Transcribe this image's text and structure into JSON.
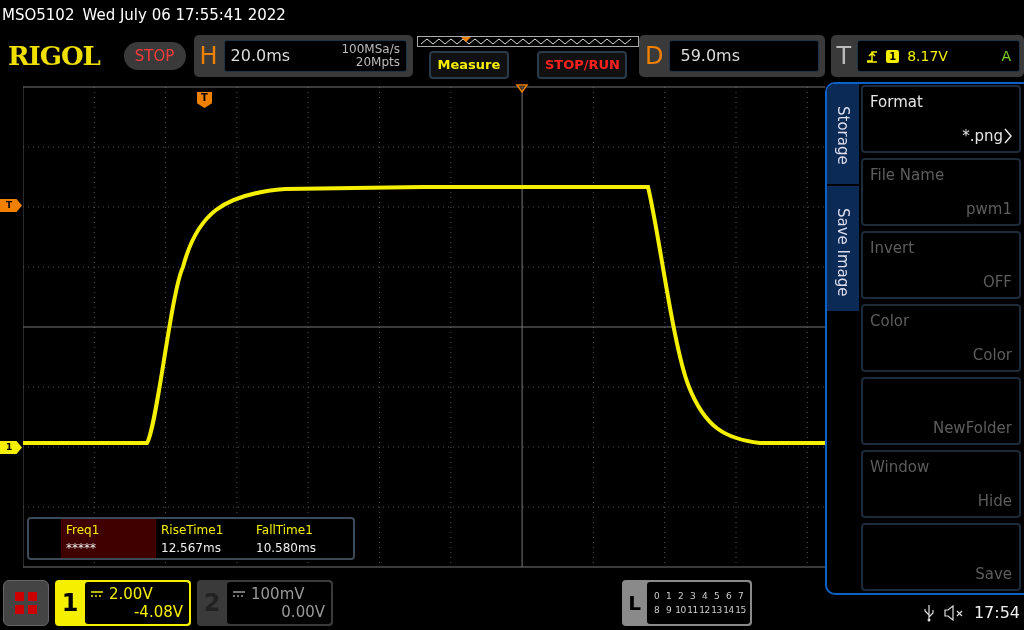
{
  "status_line": {
    "model": "MSO5102",
    "datetime": "Wed July 06 17:55:41 2022"
  },
  "toolbar": {
    "logo": "RIGOL",
    "run_state": "STOP",
    "horizontal": {
      "label": "H",
      "timebase": "20.0ms",
      "sample_rate": "100MSa/s",
      "memory_depth": "20Mpts"
    },
    "buttons": [
      {
        "label": "Measure",
        "kind": "measure"
      },
      {
        "label": "STOP/RUN",
        "kind": "run_control"
      }
    ],
    "delay": {
      "label": "D",
      "value": "59.0ms"
    },
    "trigger": {
      "label": "T",
      "source": "1",
      "level": "8.17V",
      "mode": "A"
    }
  },
  "display": {
    "markers": [
      {
        "kind": "trigger_position",
        "label": "T"
      },
      {
        "kind": "trigger_level",
        "label": "T"
      },
      {
        "kind": "channel_offset",
        "label": "1"
      }
    ]
  },
  "measurements": [
    {
      "name": "Freq1",
      "value": "*****",
      "selected": true
    },
    {
      "name": "RiseTime1",
      "value": "12.567ms",
      "selected": false
    },
    {
      "name": "FallTime1",
      "value": "10.580ms",
      "selected": false
    }
  ],
  "side_menu": {
    "tabs": [
      {
        "label": "Storage"
      },
      {
        "label": "Save Image"
      }
    ],
    "items": [
      {
        "label": "Format",
        "value": "*.png",
        "disabled": false,
        "submenu": true
      },
      {
        "label": "File Name",
        "value": "pwm1",
        "disabled": true,
        "submenu": false
      },
      {
        "label": "Invert",
        "value": "OFF",
        "disabled": true,
        "submenu": false
      },
      {
        "label": "Color",
        "value": "Color",
        "disabled": true,
        "submenu": false
      },
      {
        "value": "NewFolder",
        "disabled": true,
        "submenu": false
      },
      {
        "label": "Window",
        "value": "Hide",
        "disabled": true,
        "submenu": false
      },
      {
        "value": "Save",
        "disabled": true,
        "submenu": false
      }
    ]
  },
  "channels": [
    {
      "number": "1",
      "scale": "2.00V",
      "offset": "-4.08V",
      "selected": true
    },
    {
      "number": "2",
      "scale": "100mV",
      "offset": "0.00V",
      "selected": false
    }
  ],
  "logic": {
    "label": "L",
    "rows": [
      [
        "0",
        "1",
        "2",
        "3",
        "4",
        "5",
        "6",
        "7"
      ],
      [
        "8",
        "9",
        "10",
        "11",
        "12",
        "13",
        "14",
        "15"
      ]
    ]
  },
  "status_bar": {
    "time": "17:54"
  }
}
